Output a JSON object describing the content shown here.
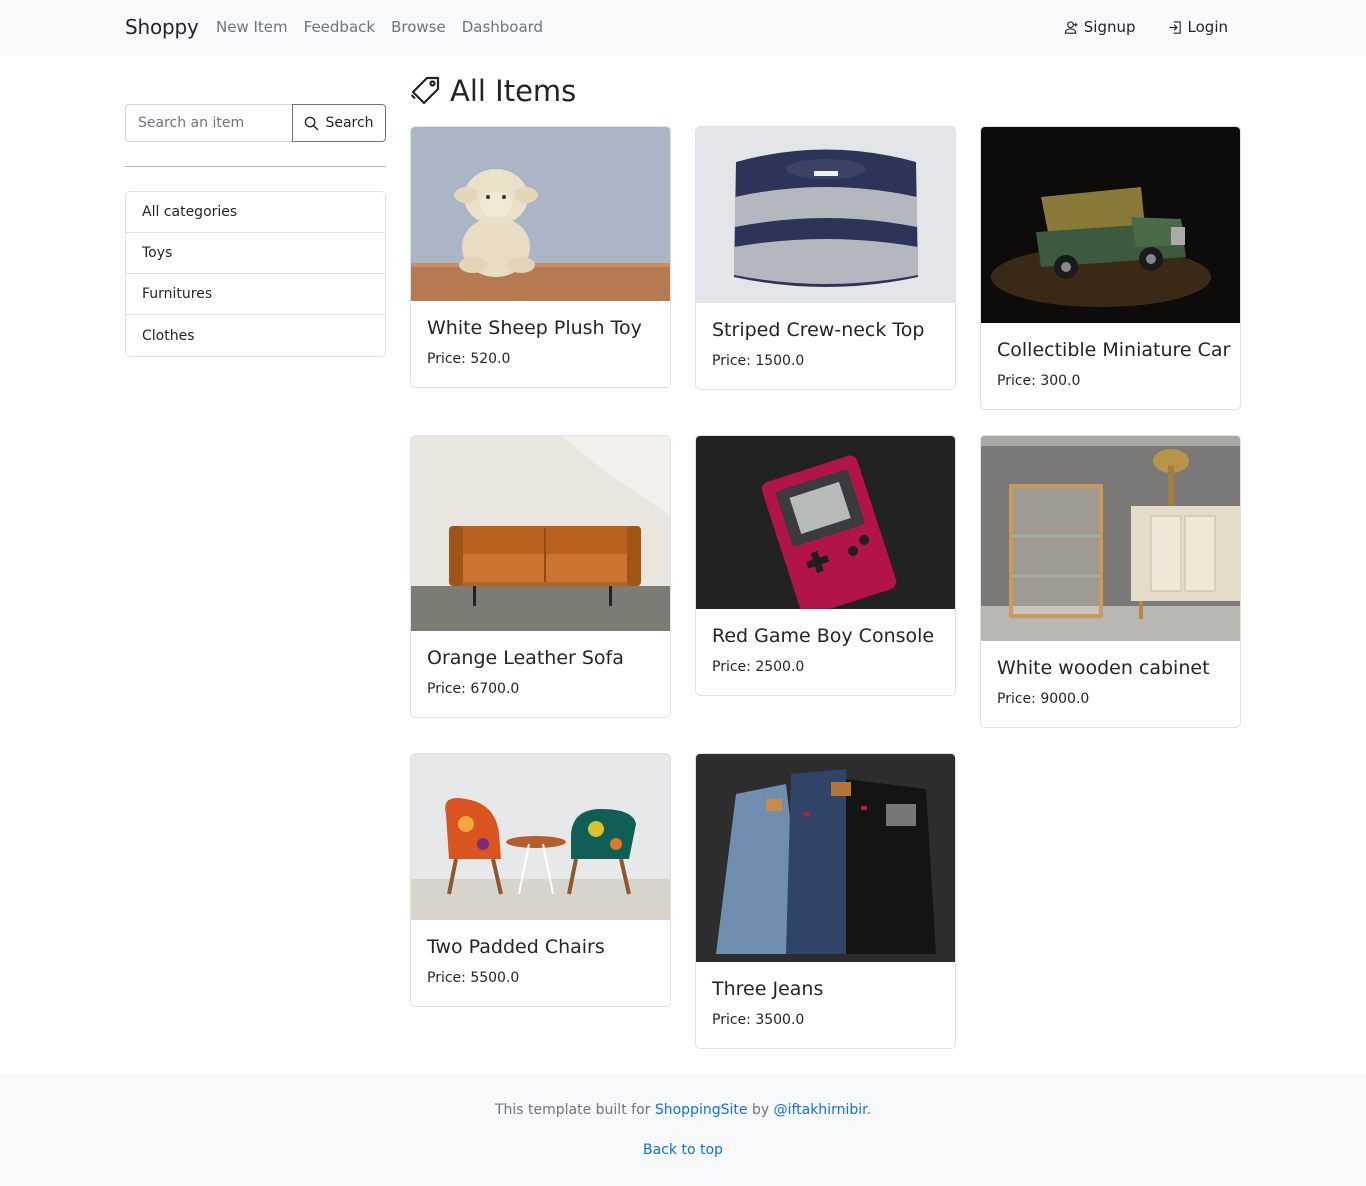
{
  "navbar": {
    "brand": "Shoppy",
    "links": [
      "New Item",
      "Feedback",
      "Browse",
      "Dashboard"
    ],
    "signup_label": "Signup",
    "login_label": "Login"
  },
  "sidebar": {
    "search_placeholder": "Search an item",
    "search_button_label": "Search",
    "categories": [
      "All categories",
      "Toys",
      "Furnitures",
      "Clothes"
    ]
  },
  "main": {
    "title": "All Items",
    "items": [
      {
        "name": "White Sheep Plush Toy",
        "price": "Price: 520.0"
      },
      {
        "name": "Striped Crew-neck Top",
        "price": "Price: 1500.0"
      },
      {
        "name": "Collectible Miniature Car",
        "price": "Price: 300.0"
      },
      {
        "name": "Orange Leather Sofa",
        "price": "Price: 6700.0"
      },
      {
        "name": "Red Game Boy Console",
        "price": "Price: 2500.0"
      },
      {
        "name": "White wooden cabinet",
        "price": "Price: 9000.0"
      },
      {
        "name": "Two Padded Chairs",
        "price": "Price: 5500.0"
      },
      {
        "name": "Three Jeans",
        "price": "Price: 3500.0"
      }
    ]
  },
  "footer": {
    "text_prefix": "This template built for",
    "site_link": "ShoppingSite",
    "text_by": "by",
    "author_link": "@iftakhirnibir",
    "text_suffix": ".",
    "back_to_top": "Back to top"
  },
  "colors": {
    "link": "#0d6efd",
    "navbar_bg": "#f8f9fa",
    "muted": "#6c757d"
  }
}
